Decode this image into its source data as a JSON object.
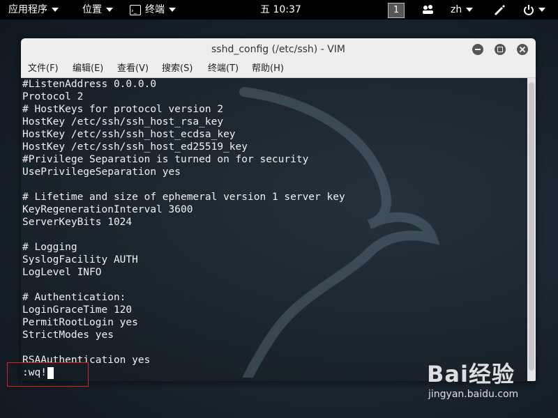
{
  "panel": {
    "apps": "应用程序",
    "places": "位置",
    "terminal": "终端",
    "clock": "五 10:37",
    "workspace": "1",
    "lang": "zh"
  },
  "window": {
    "title": "sshd_config (/etc/ssh) - VIM",
    "menu": [
      "文件(F)",
      "编辑(E)",
      "查看(V)",
      "搜索(S)",
      "终端(T)",
      "帮助(H)"
    ]
  },
  "editor": {
    "lines": [
      "#ListenAddress 0.0.0.0",
      "Protocol 2",
      "# HostKeys for protocol version 2",
      "HostKey /etc/ssh/ssh_host_rsa_key",
      "HostKey /etc/ssh/ssh_host_ecdsa_key",
      "HostKey /etc/ssh/ssh_host_ed25519_key",
      "#Privilege Separation is turned on for security",
      "UsePrivilegeSeparation yes",
      "",
      "# Lifetime and size of ephemeral version 1 server key",
      "KeyRegenerationInterval 3600",
      "ServerKeyBits 1024",
      "",
      "# Logging",
      "SyslogFacility AUTH",
      "LogLevel INFO",
      "",
      "# Authentication:",
      "LoginGraceTime 120",
      "PermitRootLogin yes",
      "StrictModes yes",
      "",
      "RSAAuthentication yes"
    ],
    "command": ":wq!"
  },
  "watermark": {
    "brand": "Bai经验",
    "url": "jingyan.baidu.com"
  },
  "colors": {
    "highlight_box": "#e02020"
  },
  "icons": [
    "caret-down-icon",
    "terminal-icon",
    "people-icon",
    "pen-icon",
    "power-icon",
    "minimize-icon",
    "maximize-icon",
    "close-icon"
  ]
}
